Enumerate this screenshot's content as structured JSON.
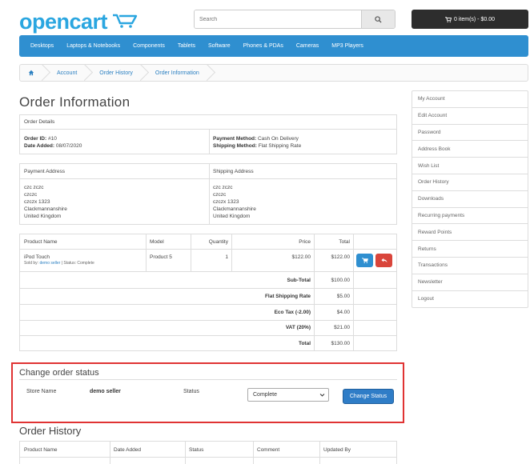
{
  "header": {
    "logo_text": "opencart",
    "search_placeholder": "Search",
    "cart_label": "0 item(s) - $0.00"
  },
  "menu": [
    "Desktops",
    "Laptops & Notebooks",
    "Components",
    "Tablets",
    "Software",
    "Phones & PDAs",
    "Cameras",
    "MP3 Players"
  ],
  "breadcrumb": [
    "Account",
    "Order History",
    "Order Information"
  ],
  "page_title": "Order Information",
  "order_details": {
    "heading": "Order Details",
    "order_id_label": "Order ID:",
    "order_id": "#10",
    "date_label": "Date Added:",
    "date": "08/07/2020",
    "payment_method_label": "Payment Method:",
    "payment_method": "Cash On Delivery",
    "shipping_method_label": "Shipping Method:",
    "shipping_method": "Flat Shipping Rate"
  },
  "addresses": {
    "payment_heading": "Payment Address",
    "shipping_heading": "Shipping Address",
    "payment_lines": [
      "czc zczc",
      "czczc",
      "czczx 1323",
      "Clackmannanshire",
      "United Kingdom"
    ],
    "shipping_lines": [
      "czc zczc",
      "czczc",
      "czczx 1323",
      "Clackmannanshire",
      "United Kingdom"
    ]
  },
  "products": {
    "headers": [
      "Product Name",
      "Model",
      "Quantity",
      "Price",
      "Total"
    ],
    "row": {
      "name": "iPod Touch",
      "sold_by_label": "Sold by:",
      "seller": "demo seller",
      "status_text": "| Status: Complete",
      "model": "Product 5",
      "quantity": "1",
      "price": "$122.00",
      "total": "$122.00"
    },
    "totals": [
      {
        "label": "Sub-Total",
        "value": "$100.00"
      },
      {
        "label": "Flat Shipping Rate",
        "value": "$5.00"
      },
      {
        "label": "Eco Tax (-2.00)",
        "value": "$4.00"
      },
      {
        "label": "VAT (20%)",
        "value": "$21.00"
      },
      {
        "label": "Total",
        "value": "$130.00"
      }
    ]
  },
  "sidebar": [
    "My Account",
    "Edit Account",
    "Password",
    "Address Book",
    "Wish List",
    "Order History",
    "Downloads",
    "Recurring payments",
    "Reward Points",
    "Returns",
    "Transactions",
    "Newsletter",
    "Logout"
  ],
  "change_status": {
    "heading": "Change order status",
    "store_label": "Store Name",
    "store_value": "demo seller",
    "status_label": "Status",
    "selected_status": "Complete",
    "button_label": "Change Status"
  },
  "order_history": {
    "heading": "Order History",
    "headers": [
      "Product Name",
      "Date Added",
      "Status",
      "Comment",
      "Updated By"
    ]
  },
  "colors": {
    "brand_blue": "#2aa6e0",
    "menu_blue": "#2f8fd0",
    "danger_red": "#d9453b",
    "highlight_border": "#e03333"
  }
}
